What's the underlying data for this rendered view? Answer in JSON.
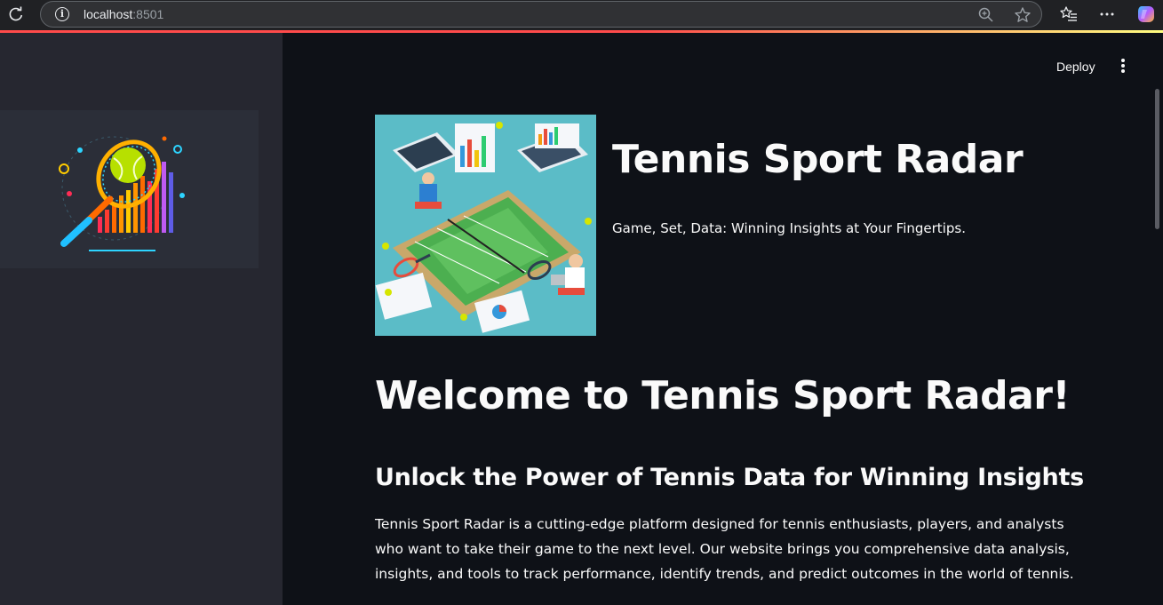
{
  "browser": {
    "url_host": "localhost",
    "url_port": ":8501"
  },
  "header": {
    "deploy_label": "Deploy"
  },
  "hero": {
    "title": "Tennis Sport Radar",
    "tagline": "Game, Set, Data: Winning Insights at Your Fingertips."
  },
  "content": {
    "welcome_heading": "Welcome to Tennis Sport Radar!",
    "subheading": "Unlock the Power of Tennis Data for Winning Insights",
    "paragraph": "Tennis Sport Radar is a cutting-edge platform designed for tennis enthusiasts, players, and analysts who want to take their game to the next level. Our website brings you comprehensive data analysis, insights, and tools to track performance, identify trends, and predict outcomes in the world of tennis."
  },
  "colors": {
    "accent": "#ff4b4b",
    "main_bg": "#0e1117",
    "sidebar_bg": "#262730"
  }
}
